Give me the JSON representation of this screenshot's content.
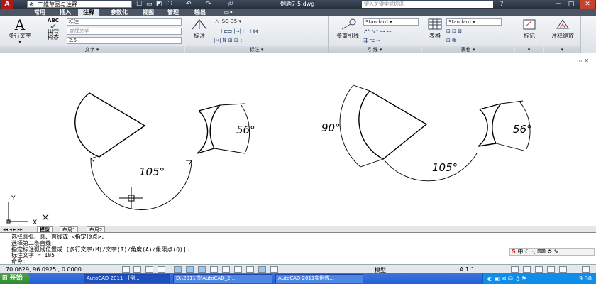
{
  "titlebar": {
    "workspace": "二维草图与注释",
    "doc_title": "例题7-5.dwg",
    "search_placeholder": "键入关键字或短语",
    "quick_access": [
      "☐",
      "▭",
      "◩",
      "⬚",
      "↶",
      "↷",
      "⎙"
    ],
    "window_buttons": [
      "?",
      "─",
      "□",
      "✕"
    ]
  },
  "tabs": [
    "常用",
    "插入",
    "注释",
    "参数化",
    "视图",
    "管理",
    "输出"
  ],
  "active_tab": "注释",
  "ribbon": {
    "text_panel": {
      "label": "文字",
      "mtext": "多行文字",
      "spell": "拼写\n检查",
      "spell_top": "ABC",
      "style": "标注",
      "find_placeholder": "查找文字",
      "height": "2.5"
    },
    "dim_panel": {
      "label": "标注",
      "dim_button": "标注",
      "dim_style": "ISO-35"
    },
    "leader_panel": {
      "label": "引线",
      "multileader": "多重引线",
      "style": "Standard"
    },
    "table_panel": {
      "label": "表格",
      "table": "表格",
      "style": "Standard"
    },
    "markup_panel": {
      "label": "标记",
      "button": "标记"
    },
    "scale_panel": {
      "label": "注释缩放",
      "button": "注释缩放"
    }
  },
  "drawing": {
    "dim1": "105°",
    "dim2": "56°",
    "dim3": "90°",
    "dim4": "105°",
    "dim5": "56°",
    "ucs_y": "Y",
    "ucs_x": "X"
  },
  "layout_tabs": [
    "模型",
    "布局1",
    "布局2"
  ],
  "command_lines": [
    "选择圆弧、圆、直线或 <指定顶点>:",
    "选择第二条直线:",
    "指定标注弧线位置或 [多行文字(M)/文字(T)/角度(A)/象限点(Q)]:",
    "标注文字 = 105",
    "命令:"
  ],
  "ime": {
    "brand": "S",
    "lang": "中"
  },
  "status": {
    "coords": "70.0629, 96.0925 , 0.0000",
    "model": "模型",
    "scale": "A 1:1"
  },
  "taskbar": {
    "start": "开始",
    "tasks": [
      "AutoCAD 2011 - [例...",
      "D:\\2011书\\AutoCAD_2...",
      "AutoCAD 2011实例教..."
    ],
    "clock": "9:30"
  }
}
